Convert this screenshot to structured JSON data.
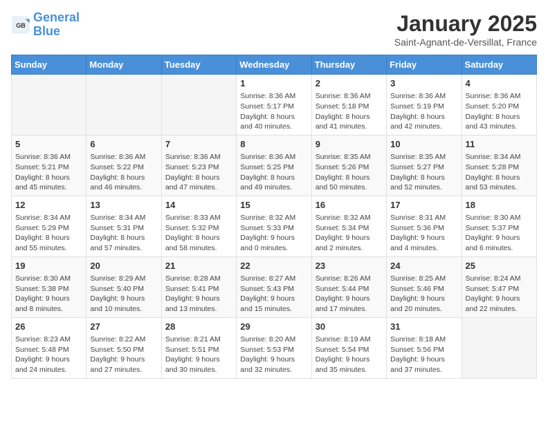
{
  "logo": {
    "line1": "General",
    "line2": "Blue"
  },
  "title": "January 2025",
  "subtitle": "Saint-Agnant-de-Versillat, France",
  "days_of_week": [
    "Sunday",
    "Monday",
    "Tuesday",
    "Wednesday",
    "Thursday",
    "Friday",
    "Saturday"
  ],
  "weeks": [
    [
      {
        "num": "",
        "info": ""
      },
      {
        "num": "",
        "info": ""
      },
      {
        "num": "",
        "info": ""
      },
      {
        "num": "1",
        "info": "Sunrise: 8:36 AM\nSunset: 5:17 PM\nDaylight: 8 hours and 40 minutes."
      },
      {
        "num": "2",
        "info": "Sunrise: 8:36 AM\nSunset: 5:18 PM\nDaylight: 8 hours and 41 minutes."
      },
      {
        "num": "3",
        "info": "Sunrise: 8:36 AM\nSunset: 5:19 PM\nDaylight: 8 hours and 42 minutes."
      },
      {
        "num": "4",
        "info": "Sunrise: 8:36 AM\nSunset: 5:20 PM\nDaylight: 8 hours and 43 minutes."
      }
    ],
    [
      {
        "num": "5",
        "info": "Sunrise: 8:36 AM\nSunset: 5:21 PM\nDaylight: 8 hours and 45 minutes."
      },
      {
        "num": "6",
        "info": "Sunrise: 8:36 AM\nSunset: 5:22 PM\nDaylight: 8 hours and 46 minutes."
      },
      {
        "num": "7",
        "info": "Sunrise: 8:36 AM\nSunset: 5:23 PM\nDaylight: 8 hours and 47 minutes."
      },
      {
        "num": "8",
        "info": "Sunrise: 8:36 AM\nSunset: 5:25 PM\nDaylight: 8 hours and 49 minutes."
      },
      {
        "num": "9",
        "info": "Sunrise: 8:35 AM\nSunset: 5:26 PM\nDaylight: 8 hours and 50 minutes."
      },
      {
        "num": "10",
        "info": "Sunrise: 8:35 AM\nSunset: 5:27 PM\nDaylight: 8 hours and 52 minutes."
      },
      {
        "num": "11",
        "info": "Sunrise: 8:34 AM\nSunset: 5:28 PM\nDaylight: 8 hours and 53 minutes."
      }
    ],
    [
      {
        "num": "12",
        "info": "Sunrise: 8:34 AM\nSunset: 5:29 PM\nDaylight: 8 hours and 55 minutes."
      },
      {
        "num": "13",
        "info": "Sunrise: 8:34 AM\nSunset: 5:31 PM\nDaylight: 8 hours and 57 minutes."
      },
      {
        "num": "14",
        "info": "Sunrise: 8:33 AM\nSunset: 5:32 PM\nDaylight: 8 hours and 58 minutes."
      },
      {
        "num": "15",
        "info": "Sunrise: 8:32 AM\nSunset: 5:33 PM\nDaylight: 9 hours and 0 minutes."
      },
      {
        "num": "16",
        "info": "Sunrise: 8:32 AM\nSunset: 5:34 PM\nDaylight: 9 hours and 2 minutes."
      },
      {
        "num": "17",
        "info": "Sunrise: 8:31 AM\nSunset: 5:36 PM\nDaylight: 9 hours and 4 minutes."
      },
      {
        "num": "18",
        "info": "Sunrise: 8:30 AM\nSunset: 5:37 PM\nDaylight: 9 hours and 6 minutes."
      }
    ],
    [
      {
        "num": "19",
        "info": "Sunrise: 8:30 AM\nSunset: 5:38 PM\nDaylight: 9 hours and 8 minutes."
      },
      {
        "num": "20",
        "info": "Sunrise: 8:29 AM\nSunset: 5:40 PM\nDaylight: 9 hours and 10 minutes."
      },
      {
        "num": "21",
        "info": "Sunrise: 8:28 AM\nSunset: 5:41 PM\nDaylight: 9 hours and 13 minutes."
      },
      {
        "num": "22",
        "info": "Sunrise: 8:27 AM\nSunset: 5:43 PM\nDaylight: 9 hours and 15 minutes."
      },
      {
        "num": "23",
        "info": "Sunrise: 8:26 AM\nSunset: 5:44 PM\nDaylight: 9 hours and 17 minutes."
      },
      {
        "num": "24",
        "info": "Sunrise: 8:25 AM\nSunset: 5:46 PM\nDaylight: 9 hours and 20 minutes."
      },
      {
        "num": "25",
        "info": "Sunrise: 8:24 AM\nSunset: 5:47 PM\nDaylight: 9 hours and 22 minutes."
      }
    ],
    [
      {
        "num": "26",
        "info": "Sunrise: 8:23 AM\nSunset: 5:48 PM\nDaylight: 9 hours and 24 minutes."
      },
      {
        "num": "27",
        "info": "Sunrise: 8:22 AM\nSunset: 5:50 PM\nDaylight: 9 hours and 27 minutes."
      },
      {
        "num": "28",
        "info": "Sunrise: 8:21 AM\nSunset: 5:51 PM\nDaylight: 9 hours and 30 minutes."
      },
      {
        "num": "29",
        "info": "Sunrise: 8:20 AM\nSunset: 5:53 PM\nDaylight: 9 hours and 32 minutes."
      },
      {
        "num": "30",
        "info": "Sunrise: 8:19 AM\nSunset: 5:54 PM\nDaylight: 9 hours and 35 minutes."
      },
      {
        "num": "31",
        "info": "Sunrise: 8:18 AM\nSunset: 5:56 PM\nDaylight: 9 hours and 37 minutes."
      },
      {
        "num": "",
        "info": ""
      }
    ]
  ]
}
